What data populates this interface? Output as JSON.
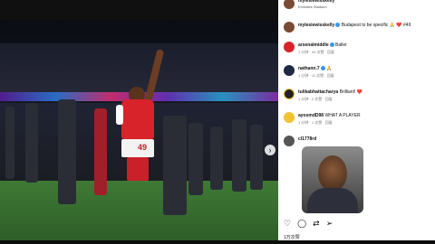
{
  "post": {
    "username": "mylesiewisskelly",
    "location": "Emirates Stadium",
    "caption_user": "mylesiewisskelly",
    "caption_text": "Budapest to be specific 🙏 ❤️ #49"
  },
  "media": {
    "shirt_number": "49",
    "slide_count": 4,
    "active_slide": 1
  },
  "comments": [
    {
      "user": "arsenalmiddle",
      "text": "Baller",
      "meta": "1 分钟 · 49 次赞 · 回复",
      "verified": true,
      "avatar_color": "#d8232a"
    },
    {
      "user": "nathann.7",
      "text": "🙏",
      "meta": "1 分钟 · 11 次赞 · 回复",
      "verified": true,
      "avatar_color": "#1e2a44"
    },
    {
      "user": "tulikabhattacharya",
      "text": "Brilliant! ❤️",
      "meta": "1 分钟 · 2 次赞 · 回复",
      "verified": false,
      "avatar_color": "#222222"
    },
    {
      "user": "ayosmdD98",
      "text": "WHAT A PLAYER",
      "meta": "1 分钟 · 1 次赞 · 回复",
      "verified": false,
      "avatar_color": "#f2c230"
    },
    {
      "user": "cl1778rd",
      "text": "",
      "meta": "",
      "verified": false,
      "avatar_color": "#555555"
    }
  ],
  "likes": "1万次赞"
}
